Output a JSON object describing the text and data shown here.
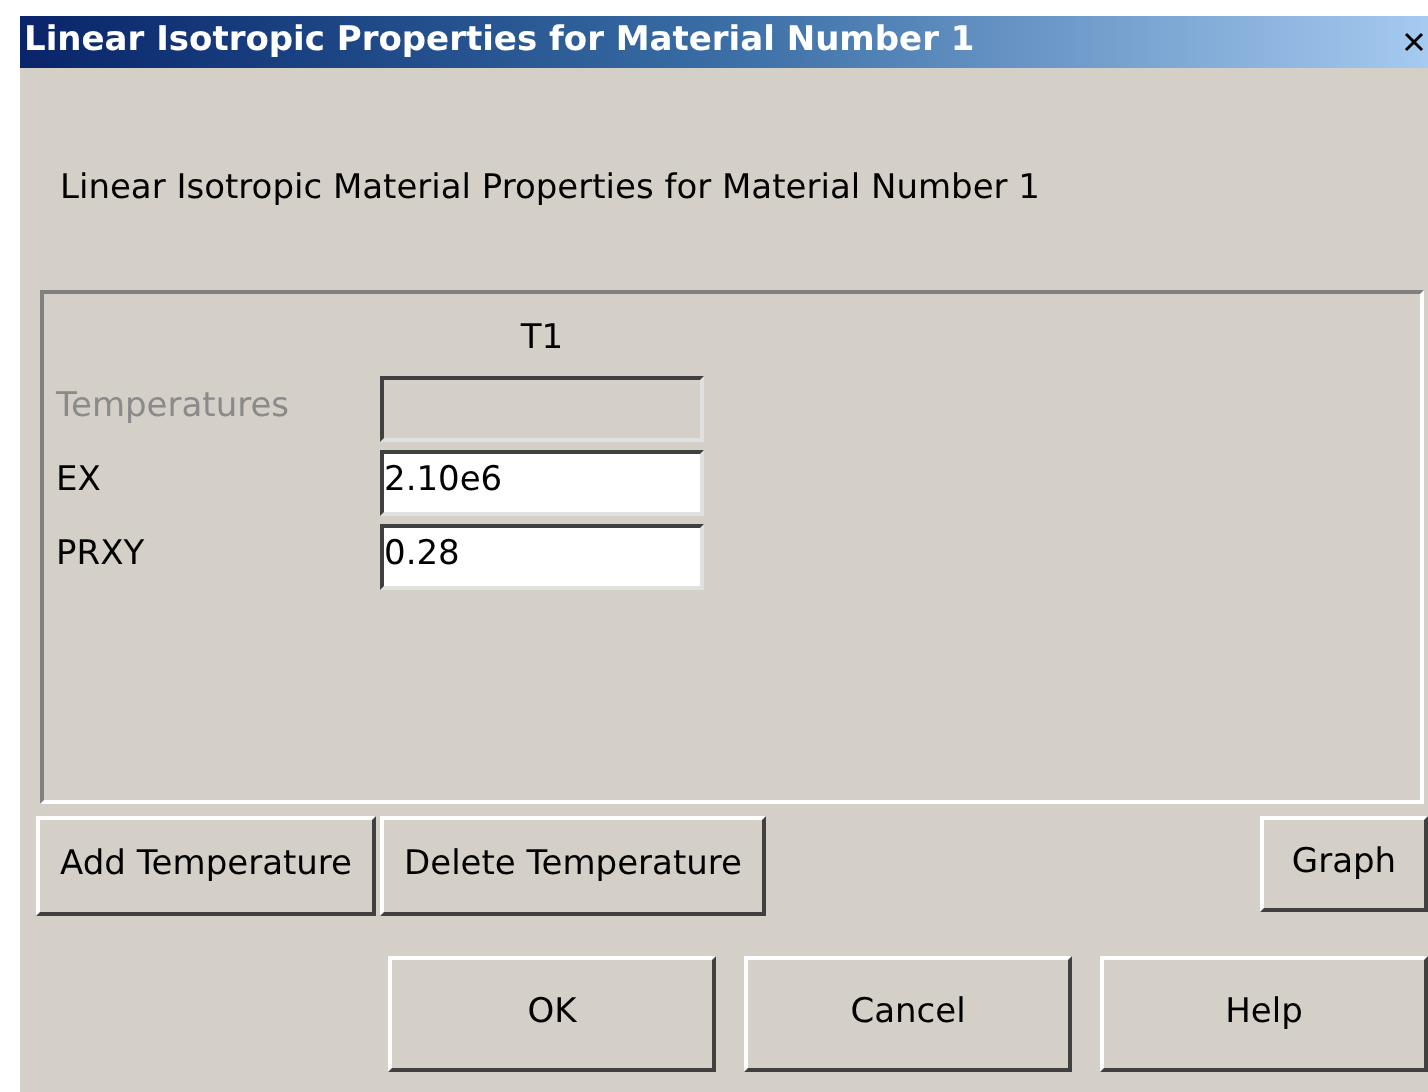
{
  "window": {
    "title": "Linear Isotropic Properties for Material Number 1"
  },
  "heading": "Linear Isotropic Material Properties for Material Number 1",
  "table": {
    "columns": [
      "T1"
    ],
    "rows": [
      {
        "label": "Temperatures",
        "disabled": true
      },
      {
        "label": "EX",
        "value": "2.10e6",
        "disabled": false
      },
      {
        "label": "PRXY",
        "value": "0.28",
        "disabled": false
      }
    ]
  },
  "row_buttons": [
    "Add Temperature",
    "Delete Temperature"
  ],
  "graph_button": "Graph",
  "buttons": [
    "OK",
    "Cancel",
    "Help"
  ]
}
